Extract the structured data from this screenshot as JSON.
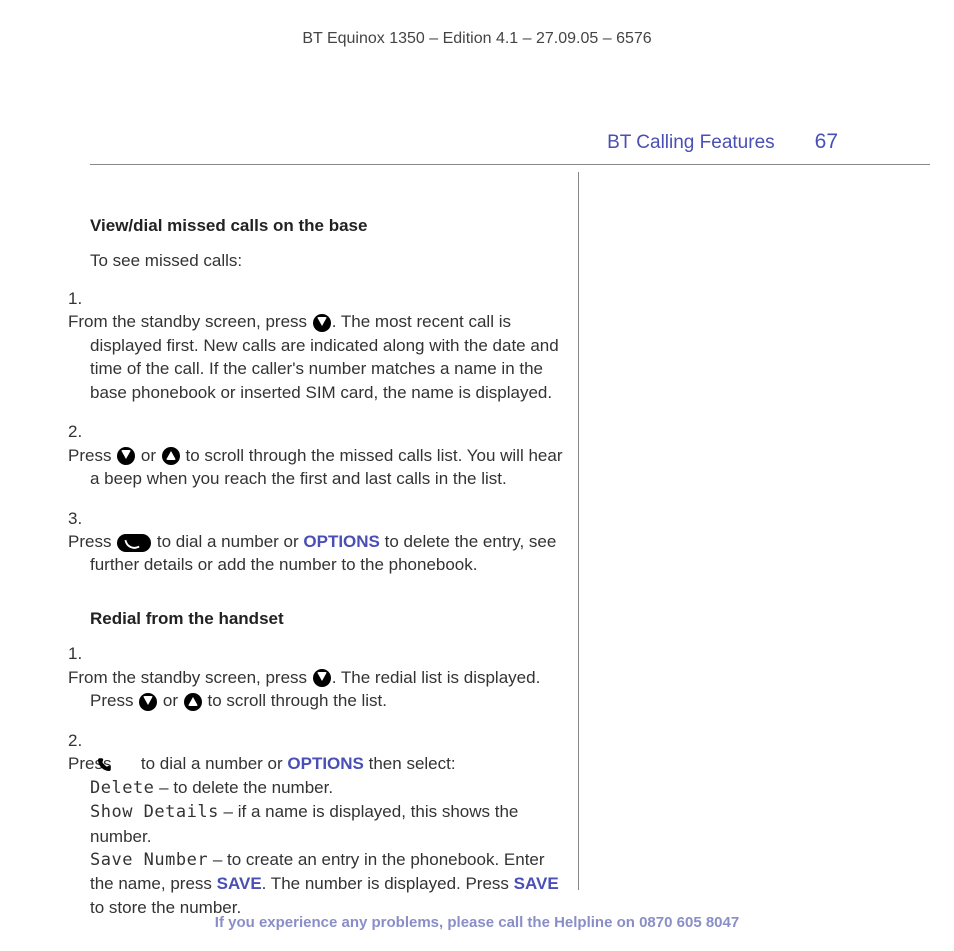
{
  "header": "BT Equinox 1350 – Edition 4.1 – 27.09.05 – 6576",
  "section_title": "BT Calling Features",
  "page_number": "67",
  "sectionA": {
    "heading": "View/dial missed calls on the base",
    "lead_in": "To see missed calls:",
    "step1_a": "From the standby screen, press ",
    "step1_b": ". The most recent call is displayed first. New calls are indicated along with the date and time of the call. If the caller's number matches a name in the base phonebook or inserted SIM card, the name is displayed.",
    "step2_a": "Press ",
    "step2_b": " or ",
    "step2_c": " to scroll through the missed calls list. You will hear a beep when you reach the first and last calls in the list.",
    "step3_a": "Press ",
    "step3_b": " to dial a number or ",
    "step3_options": "OPTIONS",
    "step3_c": " to delete the entry, see further details or add the number to the phonebook."
  },
  "sectionB": {
    "heading": "Redial from the handset",
    "step1_a": "From the standby screen, press ",
    "step1_b": ". The redial list is displayed. Press ",
    "step1_c": " or ",
    "step1_d": " to scroll through the list.",
    "step2_a": "Press ",
    "step2_b": " to dial a number or ",
    "step2_options": "OPTIONS",
    "step2_c": " then select:",
    "step2_delete_lcd": "Delete",
    "step2_delete_txt": " – to delete the number.",
    "step2_show_lcd": "Show Details",
    "step2_show_txt": " – if a name is displayed, this shows the number.",
    "step2_save_lcd": "Save Number",
    "step2_save_txt": " – to create an entry in the phonebook. Enter the name, press ",
    "step2_save_kw1": "SAVE",
    "step2_save_txt2": ". The number is displayed. Press ",
    "step2_save_kw2": "SAVE",
    "step2_save_txt3": " to store the number."
  },
  "footer_text": "If you experience any problems, please call the Helpline on ",
  "footer_phone": "0870 605 8047"
}
